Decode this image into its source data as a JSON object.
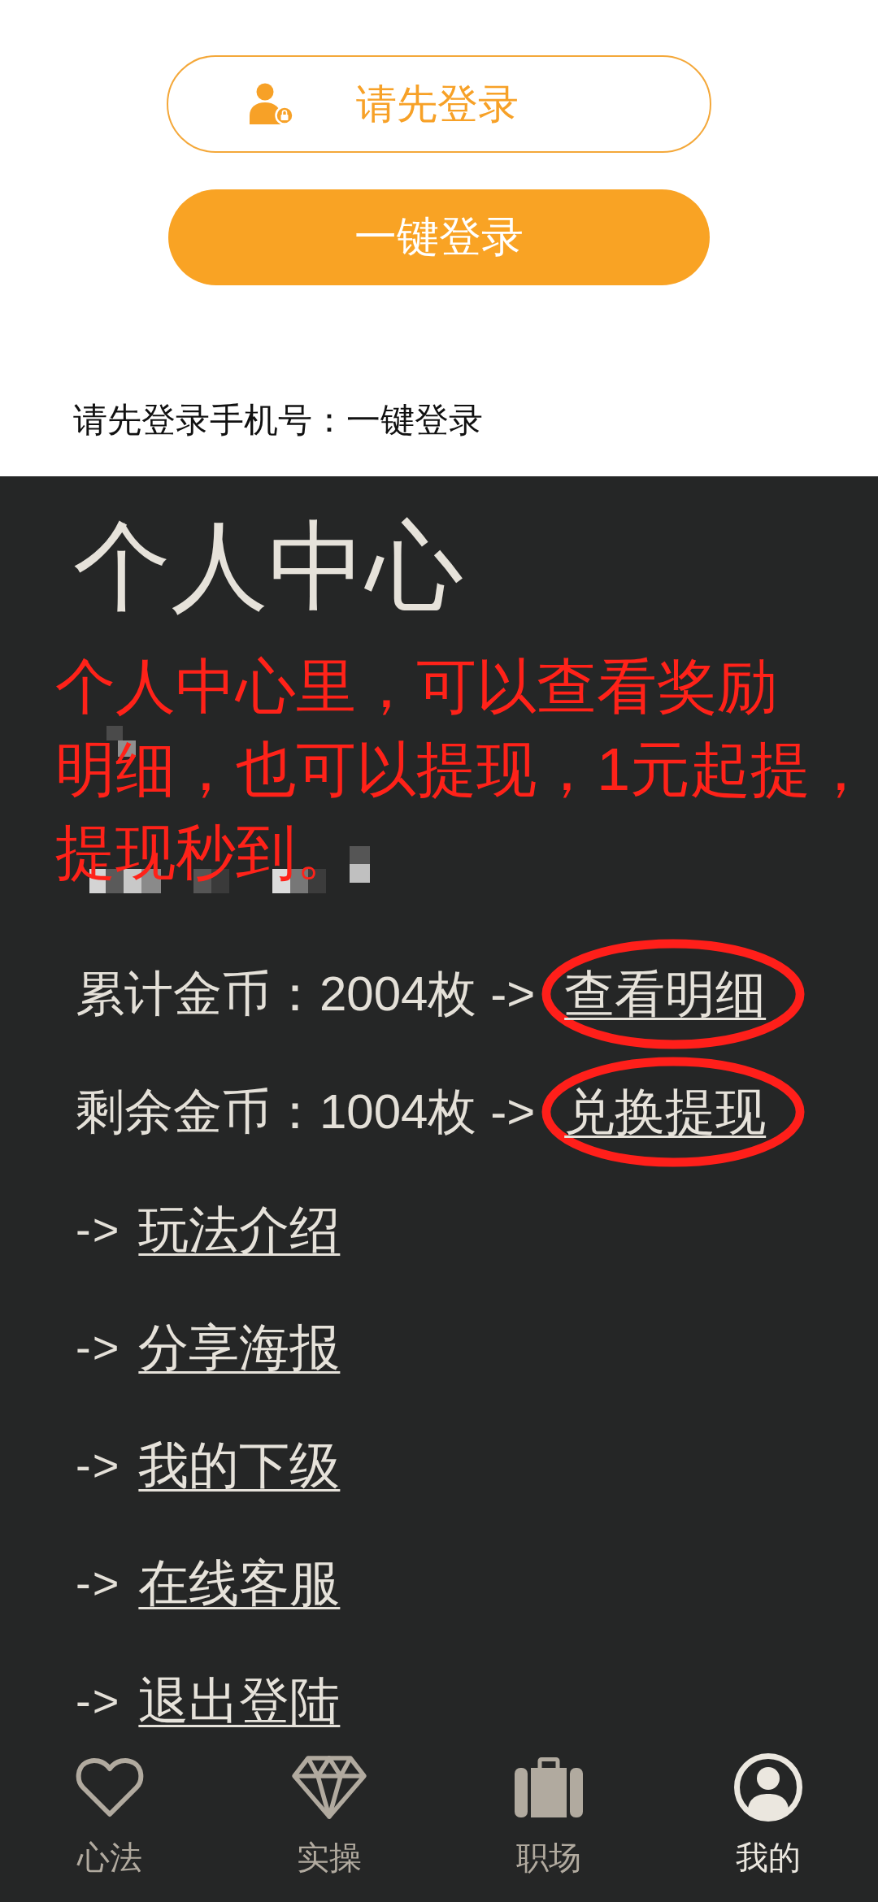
{
  "login_card": {
    "outline_button": {
      "label": "请先登录"
    },
    "primary_button": {
      "label": "一键登录"
    },
    "hint": "请先登录手机号：一键登录"
  },
  "profile": {
    "title": "个人中心",
    "annotation": "个人中心里，可以查看奖励明细，也可以提现，1元起提，提现秒到。",
    "coin_rows": [
      {
        "text": "累计金币：2004枚 ->",
        "link": "查看明细",
        "circled": true
      },
      {
        "text": "剩余金币：1004枚 ->",
        "link": "兑换提现",
        "circled": true
      }
    ],
    "links": [
      {
        "arrow": "->",
        "label": "玩法介绍"
      },
      {
        "arrow": "->",
        "label": "分享海报"
      },
      {
        "arrow": "->",
        "label": "我的下级"
      },
      {
        "arrow": "->",
        "label": "在线客服"
      },
      {
        "arrow": "->",
        "label": "退出登陆"
      }
    ]
  },
  "tab_bar": [
    {
      "label": "心法",
      "selected": false
    },
    {
      "label": "实操",
      "selected": false
    },
    {
      "label": "职场",
      "selected": false
    },
    {
      "label": "我的",
      "selected": true
    }
  ]
}
